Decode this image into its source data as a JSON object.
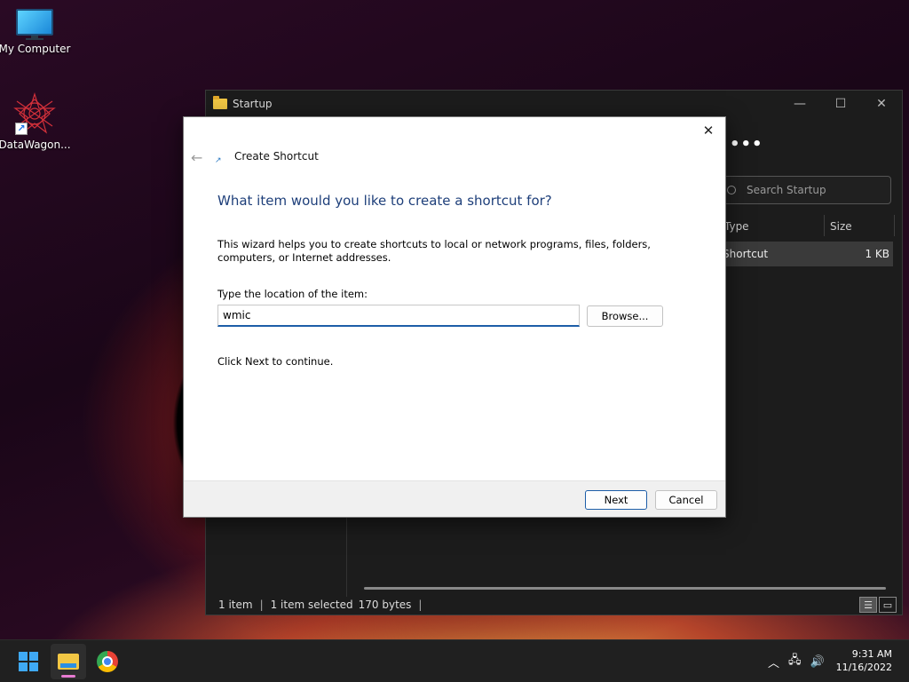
{
  "desktop": {
    "icons": [
      {
        "label": "My Computer"
      },
      {
        "label": "DataWagon..."
      }
    ]
  },
  "explorer": {
    "title": "Startup",
    "search_placeholder": "Search Startup",
    "columns": {
      "type": "Type",
      "size": "Size"
    },
    "row": {
      "type": "Shortcut",
      "size": "1 KB"
    },
    "status": {
      "count": "1 item",
      "selected": "1 item selected",
      "bytes": "170 bytes"
    }
  },
  "wizard": {
    "title": "Create Shortcut",
    "heading": "What item would you like to create a shortcut for?",
    "description": "This wizard helps you to create shortcuts to local or network programs, files, folders, computers, or Internet addresses.",
    "location_label": "Type the location of the item:",
    "location_value": "wmic ",
    "browse_label": "Browse...",
    "next_hint": "Click Next to continue.",
    "next_label": "Next",
    "cancel_label": "Cancel"
  },
  "taskbar": {
    "time": "9:31 AM",
    "date": "11/16/2022"
  },
  "colors": {
    "accent": "#1d5ea8",
    "heading": "#1e3f7a"
  }
}
